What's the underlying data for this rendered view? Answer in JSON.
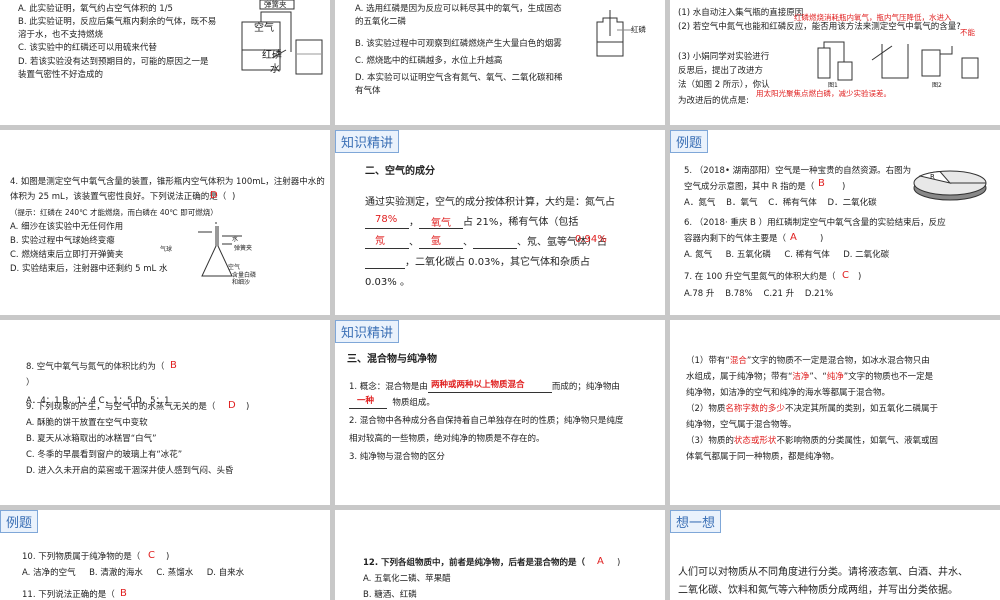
{
  "s1": {
    "top_label": "弹簧夹",
    "opts": [
      "A. 此实验证明，氧气约占空气体积的 1/5",
      "B. 此实验证明，反应后集气瓶内剩余的气体，既不易",
      "溶于水，也不支持燃烧",
      "C. 该实验中的红磷还可以用硫来代替",
      "D. 若该实验没有达到预期目的，可能的原因之一是",
      "装置气密性不好造成的"
    ],
    "fig_air": "空气",
    "fig_p": "红磷",
    "fig_water": "水"
  },
  "s2": {
    "opts": [
      "A. 选用红磷是因为反应可以耗尽其中的氧气，生成固态",
      "的五氧化二磷",
      "B. 该实验过程中可观察到红磷燃烧产生大量白色的烟雾",
      "C. 燃烧匙中的红磷越多，水位上升越高",
      "D. 本实验可以证明空气含有氮气、氧气、二氧化碳和稀",
      "有气体"
    ],
    "fig_label": "红磷"
  },
  "s3": {
    "lines": [
      "(1) 水自动注入集气瓶的直接原因",
      "(2) 若空气中氮气也能和红磷反应，能否用该方法来测定空气中氧气的含量?",
      "(3) 小娟同学对实验进行",
      "反思后，提出了改进方",
      "法（如图 2 所示），你认",
      "为改进后的优点是:"
    ],
    "ans1": "红磷燃烧消耗瓶内氧气，瓶内气压降低，水进入",
    "ans2": "不能",
    "ans3": "用太阳光聚焦点燃白磷，减少实验误差。",
    "fig1": "图1",
    "fig2": "图2"
  },
  "s4": {
    "lines": [
      "4. 如图是测定空气中氧气含量的装置，锥形瓶内空气体积为 100mL，注射器中水的",
      "体积为 25 mL，该装置气密性良好。下列说法正确的是（",
      "（提示：红磷在 240℃ 才能燃烧，而白磷在 40℃ 即可燃烧）",
      "A. 细沙在该实验中无任何作用",
      "B. 实验过程中气球始终变瘪",
      "C. 燃烧结束后立即打开弹簧夹",
      "D. 实验结束后，注射器中还剩约 5 mL 水"
    ],
    "answer": "D",
    "fig_labels": [
      "气球",
      "水",
      "弹簧夹",
      "空气",
      "白磷",
      "含量白磷",
      "和细沙"
    ]
  },
  "s5": {
    "header": "知识精讲",
    "title": "二、空气的成分",
    "p1": "通过实验测定，空气的成分按体积计算，大约是：氮气占",
    "p2_end": "占 21%，稀有气体（包括",
    "p3_end": "、氖、氩等气体）占",
    "p4_end": "，二氧化碳占 0.03%，其它气体和杂质占",
    "p5": "0.03% 。",
    "a1": "78%",
    "a2": "氧气",
    "a3": "氖",
    "a4": "氩",
    "a5": "0.94%"
  },
  "s6": {
    "header": "例题",
    "q5": "5. （2018• 湖南邵阳）空气是一种宝贵的自然资源。右图为",
    "q5b": "空气成分示意图，其中 R 指的是（",
    "q5ans": "B",
    "q5opts": [
      "A．氮气",
      "B．氧气",
      "C．稀有气体",
      "D．二氧化碳"
    ],
    "q6": "6. （2018· 重庆 B ）用红磷制定空气中氧气含量的实验结束后，反应",
    "q6b": "容器内剩下的气体主要是（",
    "q6ans": "A",
    "q6opts": [
      "A. 氮气",
      "B. 五氧化磷",
      "C. 稀有气体",
      "D. 二氧化碳"
    ],
    "q7": "7. 在 100 升空气里氮气的体积大约是（",
    "q7ans": "C",
    "q7opts": [
      "A.78 升",
      "B.78%",
      "C.21 升",
      "D.21%"
    ],
    "pie_label": "R"
  },
  "s7": {
    "q8": "8. 空气中氧气与氮气的体积比约为（",
    "q8ans": "B",
    "q8close": "）",
    "q8opts": "A．4：1    B．1：4    C．1：5    D．5：1",
    "q9": "9. 下列现象的产生，与空气中的水蒸气无关的是（",
    "q9ans": "D",
    "q9opts": [
      "A. 酥脆的饼干放置在空气中变软",
      "B. 夏天从冰箱取出的冰糕冒“白气”",
      "C. 冬季的早晨看到窗户的玻璃上有“冰花”",
      "D. 进入久未开启的菜窖或干涸深井使人感到气闷、头昏"
    ]
  },
  "s8": {
    "header": "知识精讲",
    "title": "三、混合物与纯净物",
    "l1a": "1. 概念：混合物是由",
    "l1ans": "两种或两种以上物质混合",
    "l1b": "而成的；纯净物由",
    "l2ans": "一种",
    "l2b": "物质组成。",
    "l3": "2. 混合物中各种成分各自保持着自己单独存在时的性质；纯净物只是纯度",
    "l4": "相对较高的一些物质，绝对纯净的物质是不存在的。",
    "l5": "3. 纯净物与混合物的区分"
  },
  "s9": {
    "l1a": "（1）带有“",
    "l1k": "混合",
    "l1b": "”文字的物质不一定是混合物，如冰水混合物只由",
    "l2": "水组成，属于纯净物；带有“",
    "l2k1": "洁净",
    "l2m": "”、“",
    "l2k2": "纯净",
    "l2e": "”文字的物质也不一定是",
    "l3": "纯净物，如洁净的空气和纯净的海水等都属于混合物。",
    "l4a": "（2）物质",
    "l4k": "名称字数的多少",
    "l4b": "不决定其所属的类别，如五氧化二磷属于",
    "l5": "纯净物，空气属于混合物等。",
    "l6a": "（3）物质的",
    "l6k": "状态或形状",
    "l6b": "不影响物质的分类属性，如氧气、液氧或固",
    "l7": "体氧气都属于同一种物质，都是纯净物。"
  },
  "s10": {
    "header": "例题",
    "q10": "10. 下列物质属于纯净物的是（",
    "q10ans": "C",
    "q10opts": [
      "A. 洁净的空气",
      "B. 清澈的海水",
      "C. 蒸馏水",
      "D. 自来水"
    ],
    "q11": "11. 下列说法正确的是（",
    "q11ans": "B"
  },
  "s11": {
    "q12": "12. 下列各组物质中，前者是纯净物，后者是混合物的是（",
    "q12ans": "A",
    "optA": "A. 五氧化二磷、苹果醋",
    "optB": "B. 糖酒、红磷"
  },
  "s12": {
    "header": "想一想",
    "l1": "人们可以对物质从不同角度进行分类。请将液态氧、白酒、井水、",
    "l2": "二氧化碳、饮料和氮气等六种物质分成两组，并写出分类依据。"
  }
}
